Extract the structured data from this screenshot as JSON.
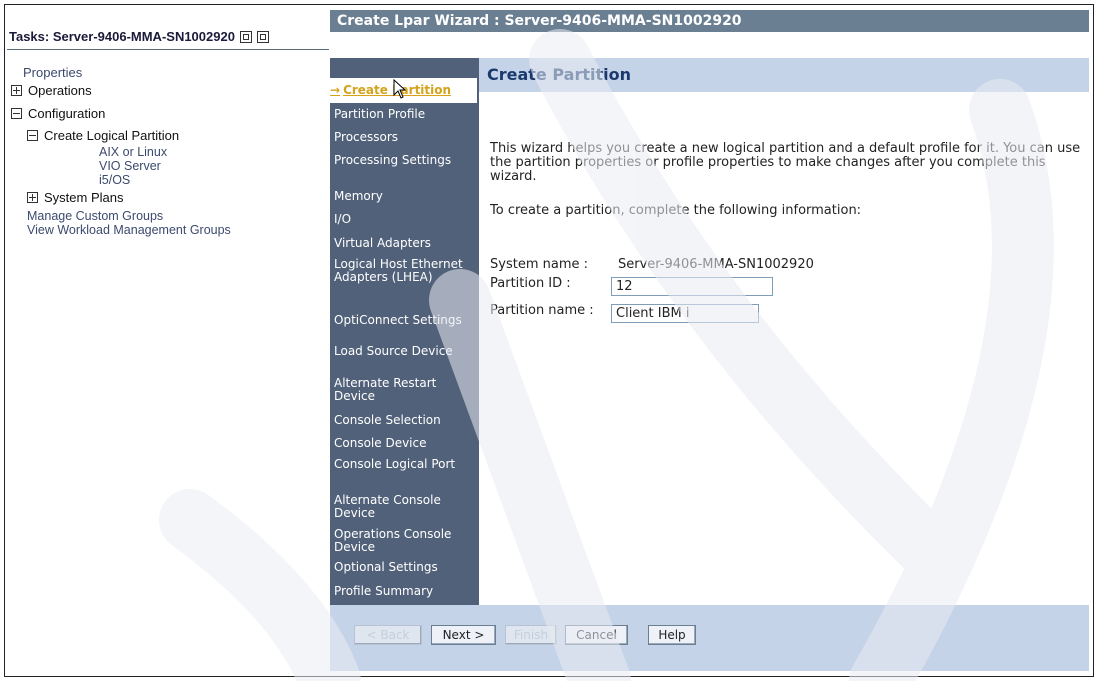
{
  "tasks_panel": {
    "title": "Tasks: Server-9406-MMA-SN1002920",
    "tree": {
      "properties": "Properties",
      "operations": "Operations",
      "configuration": "Configuration",
      "create_logical_partition": "Create Logical Partition",
      "aix_linux": "AIX or Linux",
      "vio_server": "VIO Server",
      "i5os": "i5/OS",
      "system_plans": "System Plans",
      "manage_custom_groups": "Manage Custom Groups",
      "view_workload": "View Workload Management Groups"
    }
  },
  "wizard": {
    "title": "Create Lpar Wizard : Server-9406-MMA-SN1002920",
    "nav": [
      "Create Partition",
      "Partition Profile",
      "Processors",
      "Processing Settings",
      "Memory",
      "I/O",
      "Virtual Adapters",
      "Logical Host Ethernet Adapters (LHEA)",
      "OptiConnect Settings",
      "Load Source Device",
      "Alternate Restart Device",
      "Console Selection",
      "Console Device",
      "Console Logical Port",
      "Alternate Console Device",
      "Operations Console Device",
      "Optional Settings",
      "Profile Summary"
    ],
    "nav_arrow": "→",
    "page_title": "Create Partition",
    "intro": "This wizard helps you create a new logical partition and a default profile for it. You can use the partition properties or profile properties to make changes after you complete this wizard.",
    "instruction": "To create a partition, complete the following information:",
    "system_name_label": "System name :",
    "system_name_value": "Server-9406-MMA-SN1002920",
    "partition_id_label": "Partition ID :",
    "partition_id_value": "12",
    "partition_name_label": "Partition name :",
    "partition_name_value": "Client IBM i",
    "buttons": {
      "back": "< Back",
      "next": "Next >",
      "finish": "Finish",
      "cancel": "Cancel",
      "help": "Help"
    }
  },
  "colors": {
    "nav_bg": "#52617a",
    "title_bar": "#6b7f93",
    "header_bg": "#c5d3e9",
    "current_step": "#d4a21b"
  }
}
